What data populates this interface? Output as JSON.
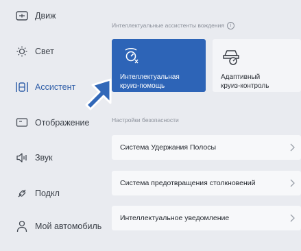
{
  "sidebar": {
    "items": [
      {
        "label": "Движ",
        "icon": "drive-mode-icon"
      },
      {
        "label": "Свет",
        "icon": "light-icon"
      },
      {
        "label": "Ассистент",
        "icon": "assistant-icon",
        "active": true
      },
      {
        "label": "Отображение",
        "icon": "display-icon"
      },
      {
        "label": "Звук",
        "icon": "sound-icon"
      },
      {
        "label": "Подкл",
        "icon": "connection-icon"
      },
      {
        "label": "Мой автомобиль",
        "icon": "profile-icon"
      }
    ]
  },
  "assistants": {
    "title": "Интеллектуальные ассистенты вождения",
    "tiles": [
      {
        "label_line1": "Интеллектуальная",
        "label_line2": "круиз-помощь",
        "active": true
      },
      {
        "label_line1": "Адаптивный",
        "label_line2": "круиз-контроль",
        "active": false
      }
    ]
  },
  "safety": {
    "title": "Настройки безопасности",
    "items": [
      {
        "label": "Система Удержания Полосы"
      },
      {
        "label": "Система предотвращения столкновений"
      },
      {
        "label": "Интеллектуальное уведомление"
      }
    ]
  },
  "colors": {
    "accent": "#2d64b7",
    "active_text": "#2f5ea8",
    "background": "#e9ebf0",
    "row_background": "#f7f8fa",
    "pointer": "#3268b8"
  }
}
